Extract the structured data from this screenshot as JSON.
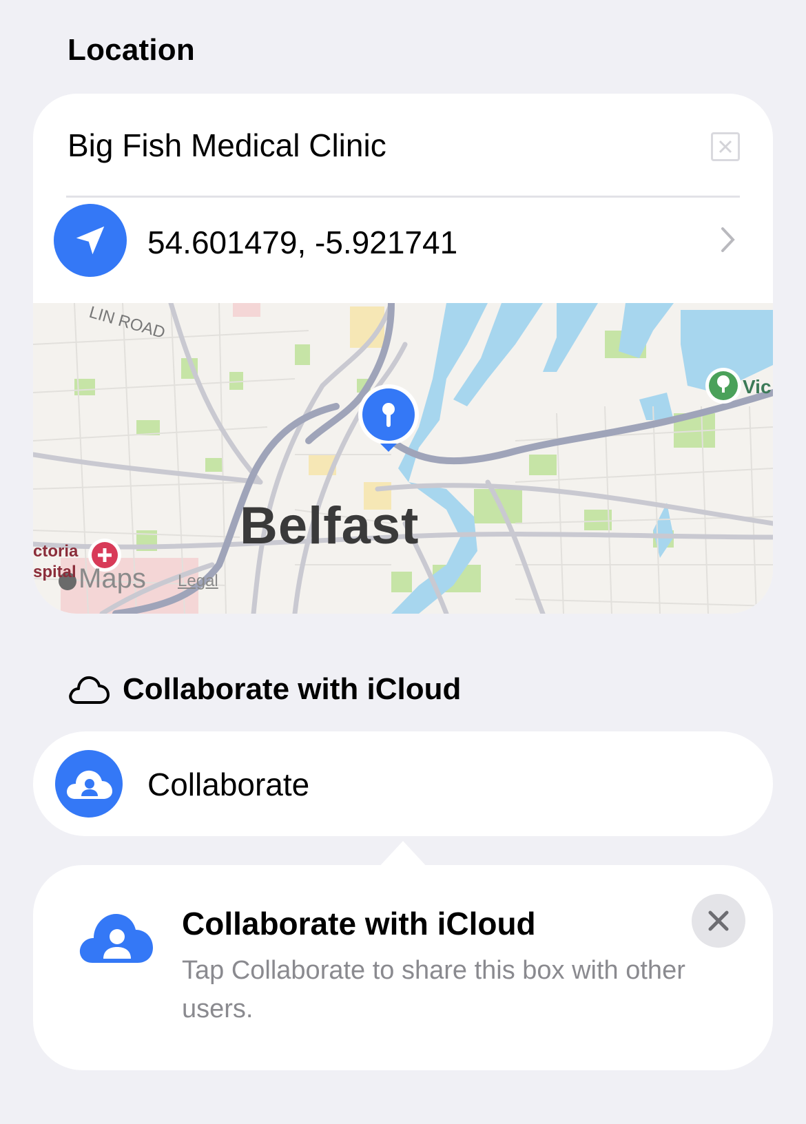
{
  "section": {
    "title": "Location"
  },
  "location": {
    "name": "Big Fish Medical Clinic",
    "coordinates": "54.601479, -5.921741"
  },
  "map": {
    "city_label": "Belfast",
    "maps_label": "Maps",
    "legal_label": "Legal",
    "poi_right": "Vic",
    "poi_left": "ctoria\nspital",
    "pin_color": "#3478f6",
    "water_color": "#a7d6ee",
    "park_color": "#c6e4a6"
  },
  "icloud": {
    "header": "Collaborate with iCloud",
    "collaborate_label": "Collaborate"
  },
  "tip": {
    "title": "Collaborate with iCloud",
    "body": "Tap Collaborate to share this box with other users."
  },
  "colors": {
    "accent": "#3478f6",
    "background": "#f0f0f5"
  }
}
